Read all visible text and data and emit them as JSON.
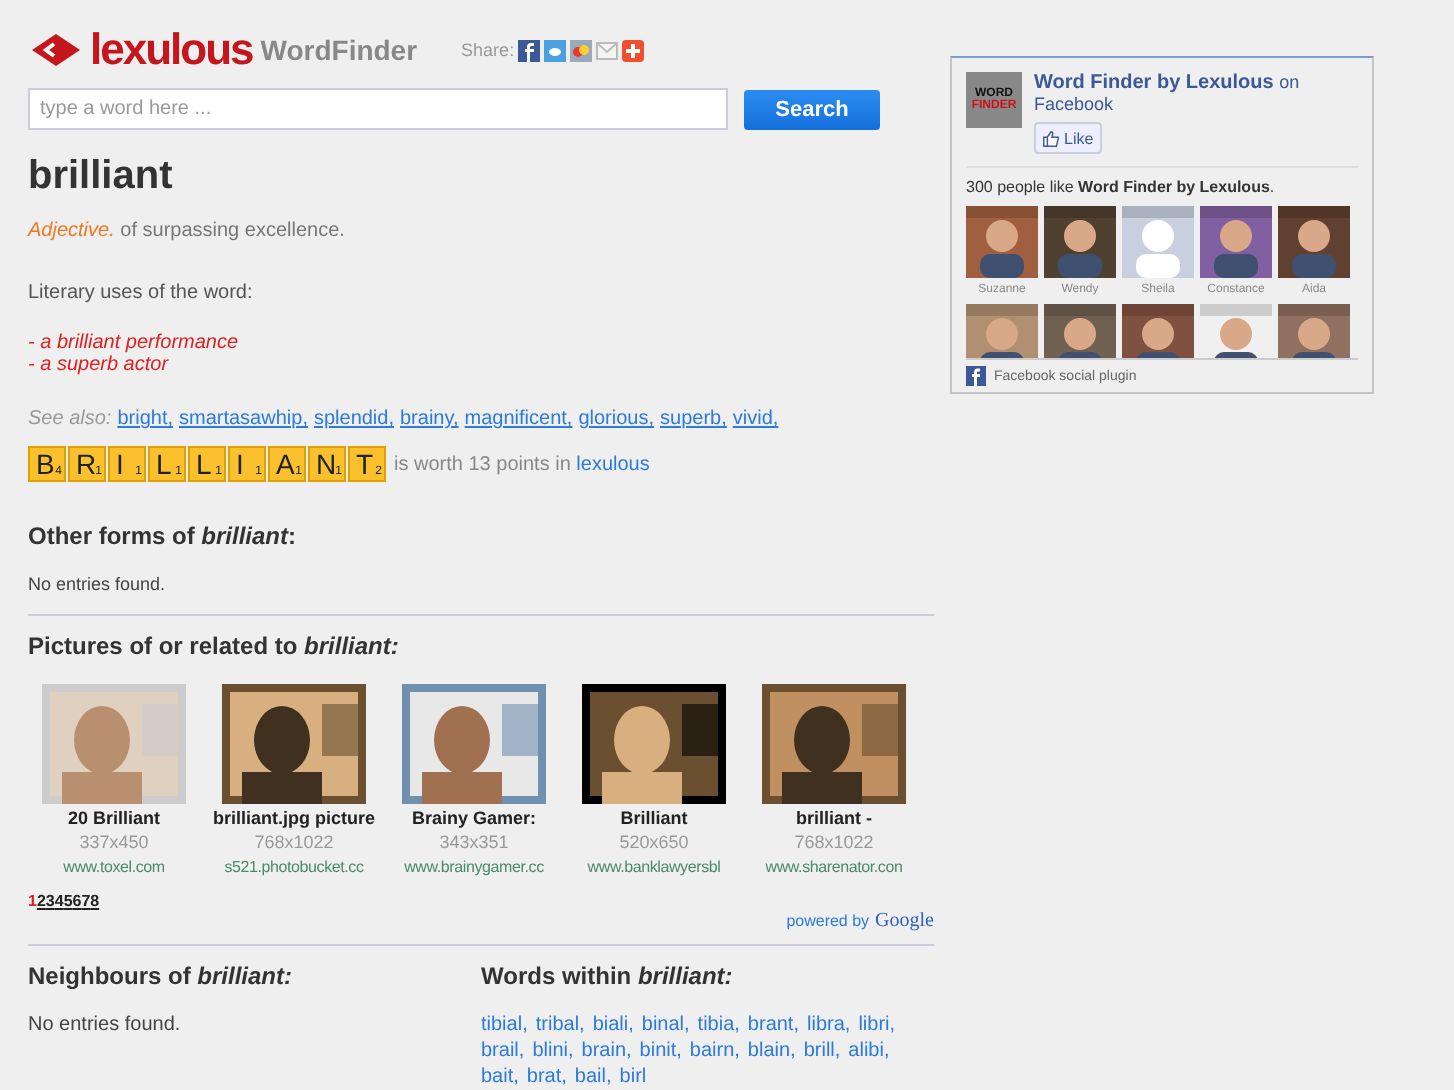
{
  "header": {
    "logo": "lexulous",
    "product": "WordFinder",
    "share_label": "Share:"
  },
  "search": {
    "placeholder": "type a word here ...",
    "button": "Search"
  },
  "word": "brilliant",
  "definition": {
    "part_of_speech": "Adjective.",
    "text": "of surpassing excellence."
  },
  "literary": {
    "title": "Literary uses of the word:",
    "items": [
      "- a brilliant performance",
      "- a superb actor"
    ]
  },
  "see_also": {
    "label": "See also:",
    "links": [
      "bright,",
      "smartasawhip,",
      "splendid,",
      "brainy,",
      "magnificent,",
      "glorious,",
      "superb,",
      "vivid,"
    ]
  },
  "tiles": [
    {
      "letter": "B",
      "points": "4"
    },
    {
      "letter": "R",
      "points": "1"
    },
    {
      "letter": "I",
      "points": "1"
    },
    {
      "letter": "L",
      "points": "1"
    },
    {
      "letter": "L",
      "points": "1"
    },
    {
      "letter": "I",
      "points": "1"
    },
    {
      "letter": "A",
      "points": "1"
    },
    {
      "letter": "N",
      "points": "1"
    },
    {
      "letter": "T",
      "points": "2"
    }
  ],
  "score": {
    "text": "is worth 13 points in",
    "link": "lexulous"
  },
  "other_forms": {
    "title": "Other forms of *brilliant*:",
    "empty": "No entries found."
  },
  "pictures": {
    "title": "Pictures of or related to *brilliant:*",
    "items": [
      {
        "kind": "picture",
        "caption": "20 Brilliant",
        "size": "337x450",
        "site": "www.toxel.com"
      },
      {
        "kind": "picture",
        "caption": "brilliant.jpg picture",
        "size": "768x1022",
        "site": "s521.photobucket.cc"
      },
      {
        "kind": "picture",
        "caption": "Brainy Gamer:",
        "size": "343x351",
        "site": "www.brainygamer.cc"
      },
      {
        "kind": "picture",
        "caption": "Brilliant",
        "size": "520x650",
        "site": "www.banklawyersbl"
      },
      {
        "kind": "picture",
        "caption": "brilliant -",
        "size": "768x1022",
        "site": "www.sharenator.con"
      }
    ],
    "pages": [
      {
        "label": "1",
        "selected": true
      },
      {
        "label": "2",
        "selected": false
      },
      {
        "label": "3",
        "selected": false
      },
      {
        "label": "4",
        "selected": false
      },
      {
        "label": "5",
        "selected": false
      },
      {
        "label": "6",
        "selected": false
      },
      {
        "label": "7",
        "selected": false
      },
      {
        "label": "8",
        "selected": false
      }
    ],
    "powered_by": "powered by",
    "google": "Google"
  },
  "neighbours": {
    "title": "Neighbours of *brilliant:*",
    "empty": "No entries found."
  },
  "words_within": {
    "title": "Words within *brilliant:*",
    "words": [
      "tibial,",
      "tribal,",
      "biali,",
      "binal,",
      "tibia,",
      "brant,",
      "libra,",
      "libri,",
      "brail,",
      "blini,",
      "brain,",
      "binit,",
      "bairn,",
      "blain,",
      "brill,",
      "alibi,",
      "bait,",
      "brat,",
      "bail,",
      "birl"
    ]
  },
  "facebook": {
    "page_name": "Word Finder by Lexulous",
    "on": "on",
    "site": "Facebook",
    "like": "Like",
    "logo_top": "WORD",
    "logo_bottom": "FINDER",
    "count_text": "300 people like **Word Finder by Lexulous**.",
    "plugin": "Facebook social plugin",
    "fans": [
      {
        "name": "Suzanne"
      },
      {
        "name": "Wendy"
      },
      {
        "name": "Sheila"
      },
      {
        "name": "Constance"
      },
      {
        "name": "Aida"
      }
    ]
  }
}
